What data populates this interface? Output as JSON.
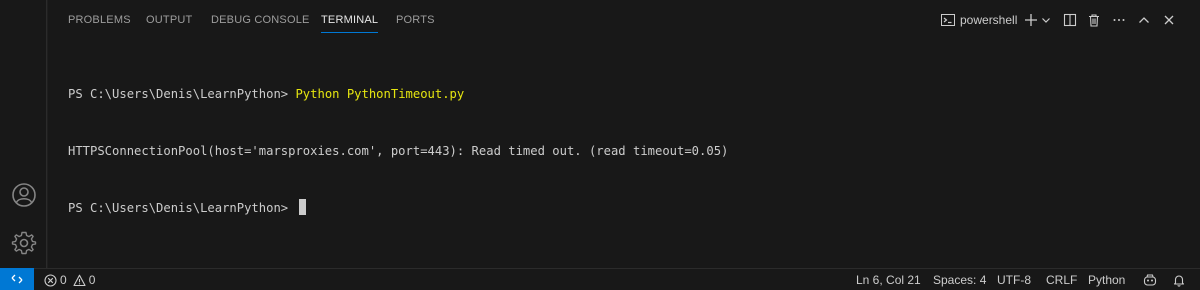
{
  "panel": {
    "tabs": [
      {
        "label": "PROBLEMS"
      },
      {
        "label": "OUTPUT"
      },
      {
        "label": "DEBUG CONSOLE"
      },
      {
        "label": "TERMINAL",
        "active": true
      },
      {
        "label": "PORTS"
      }
    ],
    "shell": "powershell"
  },
  "terminal": {
    "lines": [
      {
        "prompt": "PS C:\\Users\\Denis\\LearnPython> ",
        "command": "Python PythonTimeout.py"
      },
      {
        "text": "HTTPSConnectionPool(host='marsproxies.com', port=443): Read timed out. (read timeout=0.05)"
      },
      {
        "prompt": "PS C:\\Users\\Denis\\LearnPython> "
      }
    ]
  },
  "statusbar": {
    "errors": "0",
    "warnings": "0",
    "position": "Ln 6, Col 21",
    "spaces": "Spaces: 4",
    "encoding": "UTF-8",
    "eol": "CRLF",
    "language": "Python"
  },
  "icons": {
    "account": "account-icon",
    "manage": "gear-icon",
    "remote": "remote-icon",
    "terminal": "terminal-icon",
    "add": "plus-icon",
    "split": "split-icon",
    "kill": "trash-icon",
    "more": "ellipsis-icon",
    "maximize": "chevron-up-icon",
    "close": "close-icon",
    "copilot": "copilot-icon",
    "notifications": "bell-icon"
  },
  "colors": {
    "accent": "#0078d4",
    "command": "#e5e510",
    "background": "#181818"
  }
}
